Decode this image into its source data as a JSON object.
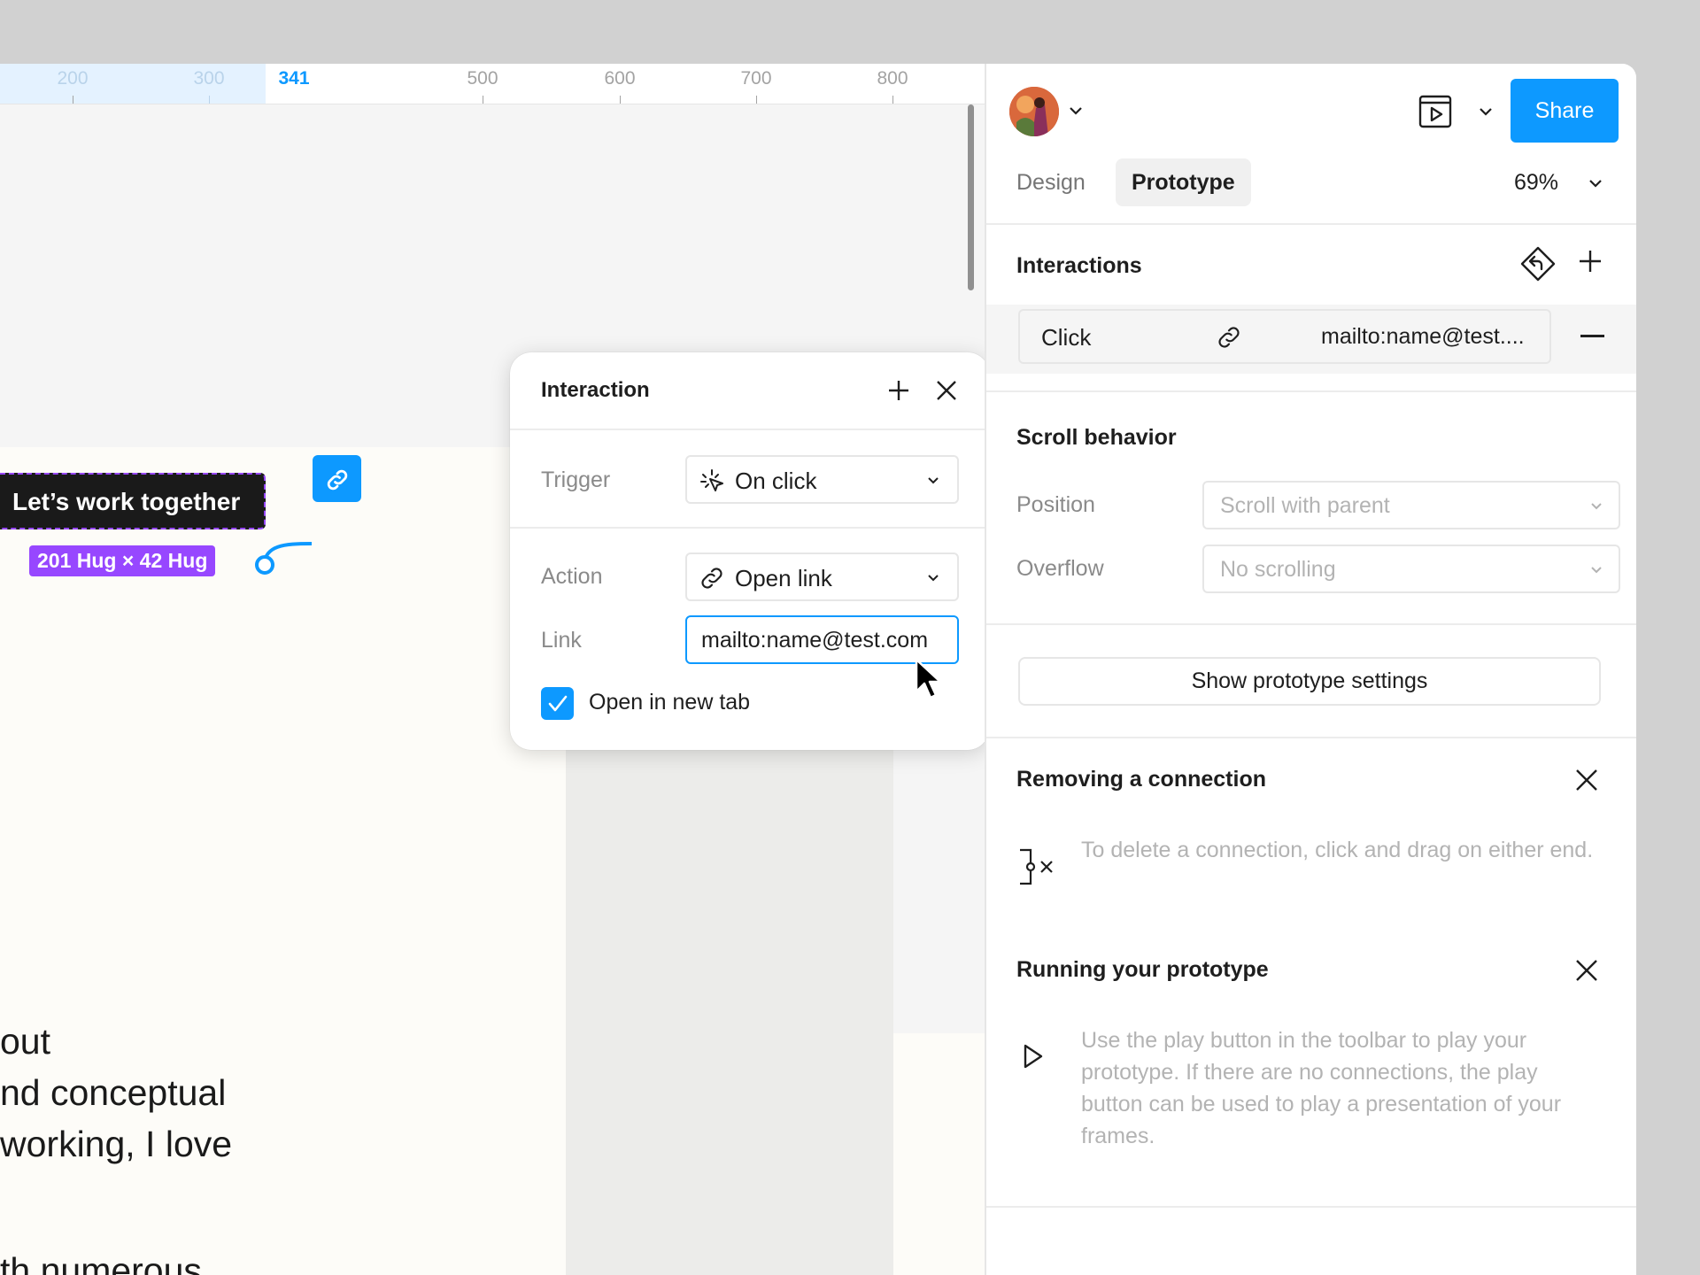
{
  "canvas": {
    "ruler": {
      "ticks": [
        "200",
        "300",
        "341",
        "500",
        "600",
        "700",
        "800"
      ]
    },
    "button_text": "Let’s work together",
    "size_badge": "201 Hug × 42 Hug",
    "body_lines": [
      "out",
      "nd conceptual",
      "working, I love",
      "th numerous"
    ]
  },
  "interaction_popover": {
    "title": "Interaction",
    "trigger_label": "Trigger",
    "trigger_value": "On click",
    "action_label": "Action",
    "action_value": "Open link",
    "link_label": "Link",
    "link_value": "mailto:name@test.com",
    "open_new_tab_label": "Open in new tab",
    "open_new_tab_checked": true
  },
  "panel": {
    "share_label": "Share",
    "tabs": [
      {
        "label": "Design",
        "active": false
      },
      {
        "label": "Prototype",
        "active": true
      }
    ],
    "zoom": "69%",
    "interactions": {
      "title": "Interactions",
      "row": {
        "trigger": "Click",
        "destination": "mailto:name@test...."
      }
    },
    "scroll_behavior": {
      "title": "Scroll behavior",
      "position_label": "Position",
      "position_value": "Scroll with parent",
      "overflow_label": "Overflow",
      "overflow_value": "No scrolling"
    },
    "prototype_settings_button": "Show prototype settings",
    "tips": [
      {
        "title": "Removing a connection",
        "icon": "disconnect-icon",
        "text": "To delete a connection, click and drag on either end."
      },
      {
        "title": "Running your prototype",
        "icon": "play-icon",
        "text": "Use the play button in the toolbar to play your prototype. If there are no connections, the play button can be used to play a presentation of your frames."
      }
    ]
  },
  "colors": {
    "accent": "#0d99ff",
    "selection": "#9747ff",
    "canvas_bg": "#f5f5f5",
    "frame_bg": "#fdfcf8"
  }
}
